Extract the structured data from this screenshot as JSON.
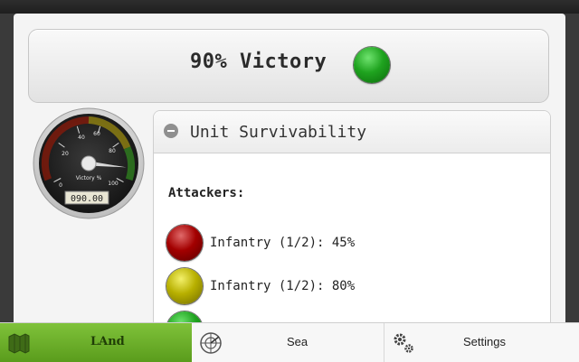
{
  "banner": {
    "text": "90% Victory",
    "status_color": "#1fa31f"
  },
  "gauge": {
    "value": 90,
    "readout": "090.00",
    "label": "Victory %",
    "ticks": [
      "0",
      "20",
      "40",
      "60",
      "80",
      "100"
    ],
    "zone_colors": {
      "low": "#8a1a0a",
      "mid": "#9a8a10",
      "high": "#2f7f1f"
    }
  },
  "panel": {
    "title": "Unit Survivability",
    "collapse_icon": "minus-circle-icon",
    "section_label": "Attackers:",
    "units": [
      {
        "label": "Infantry (1/2): 45%",
        "status": "red"
      },
      {
        "label": "Infantry (1/2): 80%",
        "status": "yellow"
      },
      {
        "label": "",
        "status": "green"
      }
    ]
  },
  "tabs": [
    {
      "label": "LAnd",
      "icon": "map-icon",
      "active": true
    },
    {
      "label": "Sea",
      "icon": "radar-icon",
      "active": false
    },
    {
      "label": "Settings",
      "icon": "gears-icon",
      "active": false
    }
  ]
}
